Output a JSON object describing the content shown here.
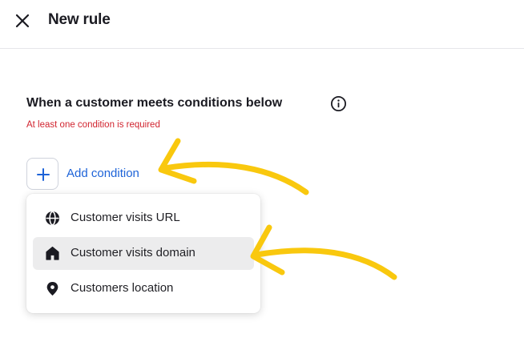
{
  "header": {
    "title": "New rule",
    "close_icon": "close-icon"
  },
  "section": {
    "title": "When a customer meets conditions below",
    "info_icon": "info-icon",
    "error": "At least one condition is required"
  },
  "add_condition": {
    "label": "Add condition",
    "icon": "plus-icon"
  },
  "menu": {
    "items": [
      {
        "label": "Customer visits URL",
        "icon": "globe-icon",
        "highlighted": false
      },
      {
        "label": "Customer visits domain",
        "icon": "home-icon",
        "highlighted": true
      },
      {
        "label": "Customers location",
        "icon": "location-pin-icon",
        "highlighted": false
      }
    ]
  },
  "annotations": {
    "arrow_color": "#f9c80e"
  },
  "colors": {
    "accent": "#1d63d8",
    "error": "#d1242f",
    "hover": "#ececed"
  }
}
